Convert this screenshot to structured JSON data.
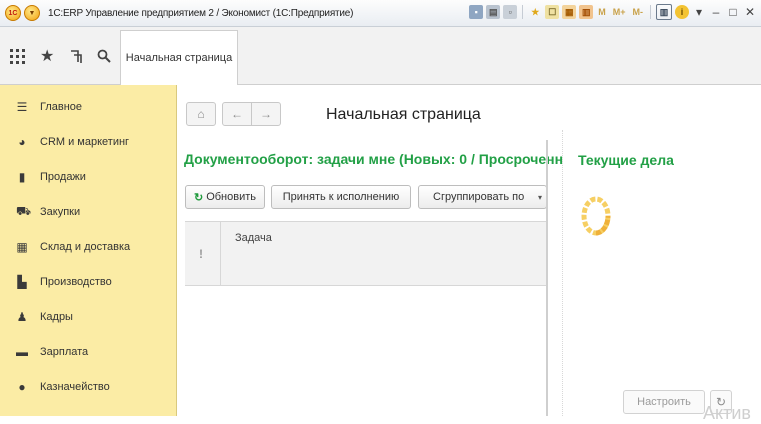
{
  "window": {
    "title": "1С:ERP Управление предприятием 2 / Экономист  (1С:Предприятие)",
    "logo_text": "1С",
    "toolbar_memory": [
      "M",
      "M+",
      "M-"
    ]
  },
  "tabs": [
    {
      "label": "Начальная страница",
      "active": true
    }
  ],
  "sidebar": {
    "items": [
      {
        "label": "Главное",
        "icon": "menu-lines-icon"
      },
      {
        "label": "CRM и маркетинг",
        "icon": "pie-chart-icon"
      },
      {
        "label": "Продажи",
        "icon": "shopping-bag-icon"
      },
      {
        "label": "Закупки",
        "icon": "shopping-cart-icon"
      },
      {
        "label": "Склад и доставка",
        "icon": "warehouse-grid-icon"
      },
      {
        "label": "Производство",
        "icon": "factory-icon"
      },
      {
        "label": "Кадры",
        "icon": "person-icon"
      },
      {
        "label": "Зарплата",
        "icon": "wallet-icon"
      },
      {
        "label": "Казначейство",
        "icon": "ruble-coin-icon"
      }
    ]
  },
  "main": {
    "page_title": "Начальная страница",
    "tasks": {
      "title": "Документооборот: задачи мне (Новых: 0 / Просроченн",
      "buttons": {
        "refresh": "Обновить",
        "accept": "Принять к исполнению",
        "group": "Сгруппировать по"
      },
      "table": {
        "importance_header": "!",
        "columns": [
          "Задача"
        ]
      }
    },
    "current": {
      "title": "Текущие дела",
      "settings_button": "Настроить"
    },
    "watermark": "Актив"
  },
  "colors": {
    "sidebar_bg": "#fbeca5",
    "accent_green": "#22a046",
    "spinner": "#f6cf63"
  }
}
